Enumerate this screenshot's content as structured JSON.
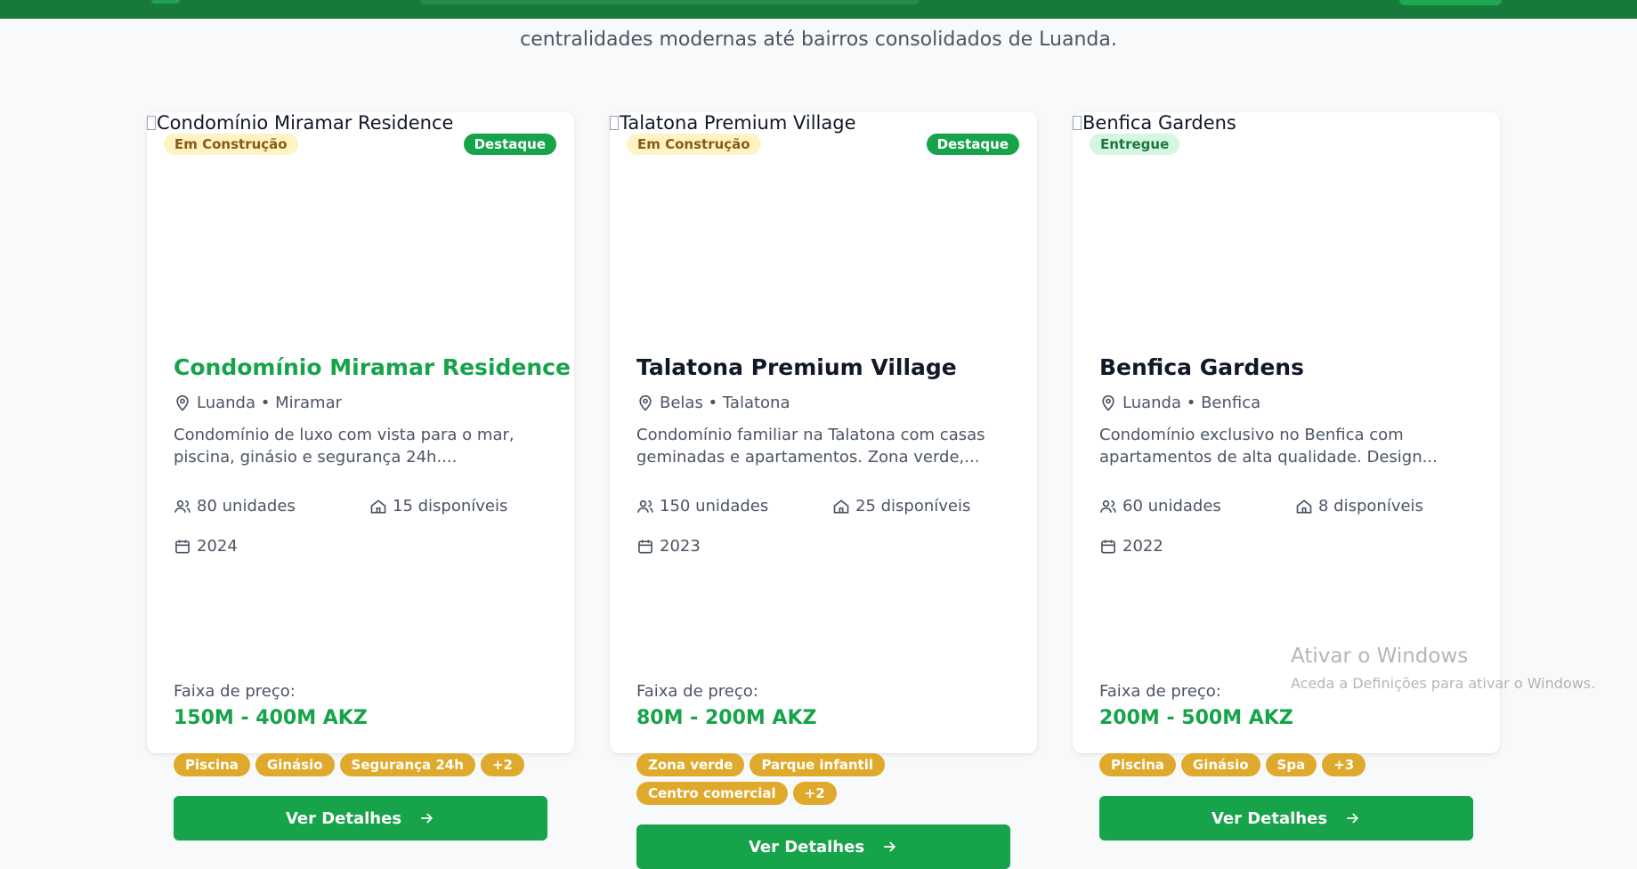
{
  "intro": {
    "line2": "centralidades modernas até bairros consolidados de Luanda."
  },
  "colors": {
    "brand_green": "#16a34a",
    "header_green": "#177a3c",
    "tag_gold": "#dfa92b"
  },
  "cards": [
    {
      "image_alt": "Condomínio Miramar Residence",
      "status": "Em Construção",
      "featured": "Destaque",
      "title": "Condomínio Miramar Residence",
      "location": "Luanda • Miramar",
      "description_line1": "Condomínio de luxo com vista para o mar,",
      "description_line2": "piscina, ginásio e segurança 24h....",
      "units": "80 unidades",
      "available": "15 disponíveis",
      "year": "2024",
      "price_label": "Faixa de preço:",
      "price": "150M - 400M AKZ",
      "tags": [
        "Piscina",
        "Ginásio",
        "Segurança 24h",
        "+2"
      ],
      "button": "Ver Detalhes"
    },
    {
      "image_alt": "Talatona Premium Village",
      "status": "Em Construção",
      "featured": "Destaque",
      "title": "Talatona Premium Village",
      "location": "Belas • Talatona",
      "description_line1": "Condomínio familiar na Talatona com casas",
      "description_line2": "geminadas e apartamentos. Zona verde,...",
      "units": "150 unidades",
      "available": "25 disponíveis",
      "year": "2023",
      "price_label": "Faixa de preço:",
      "price": "80M - 200M AKZ",
      "tags": [
        "Zona verde",
        "Parque infantil",
        "Centro comercial",
        "+2"
      ],
      "button": "Ver Detalhes"
    },
    {
      "image_alt": "Benfica Gardens",
      "status": "Entregue",
      "title": "Benfica Gardens",
      "location": "Luanda • Benfica",
      "description_line1": "Condomínio exclusivo no Benfica com",
      "description_line2": "apartamentos de alta qualidade. Design...",
      "units": "60 unidades",
      "available": "8 disponíveis",
      "year": "2022",
      "price_label": "Faixa de preço:",
      "price": "200M - 500M AKZ",
      "tags": [
        "Piscina",
        "Ginásio",
        "Spa",
        "+3"
      ],
      "button": "Ver Detalhes"
    }
  ],
  "watermark": {
    "title": "Ativar o Windows",
    "subtitle": "Aceda a Definições para ativar o Windows."
  }
}
